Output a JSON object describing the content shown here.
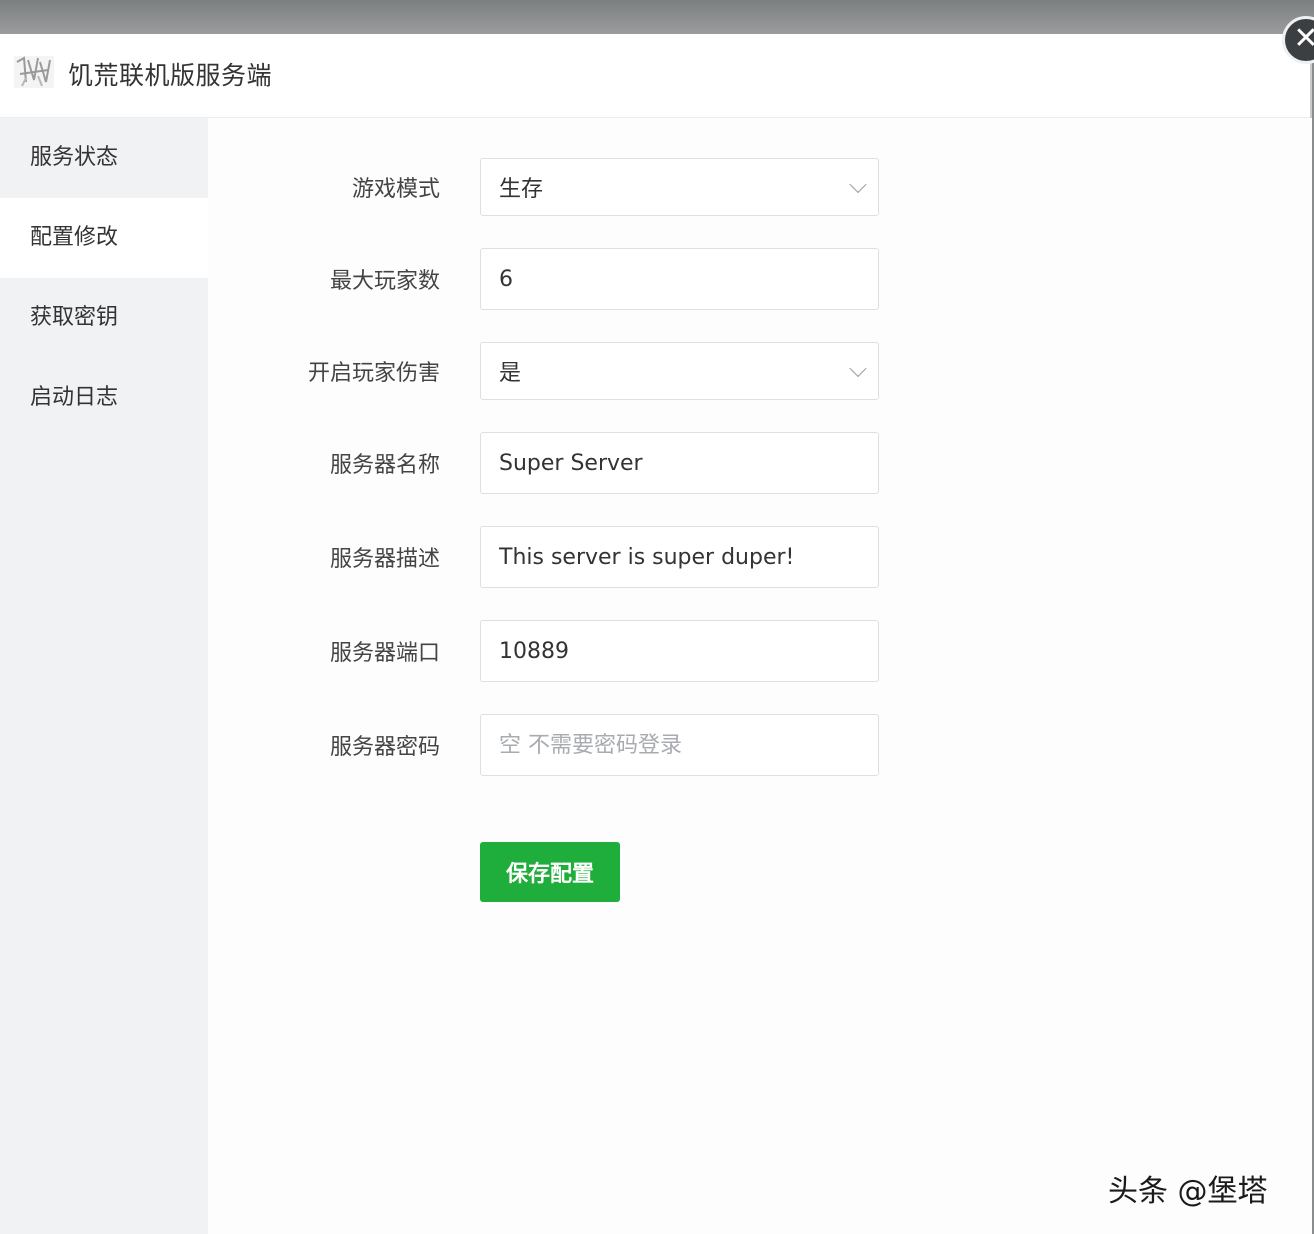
{
  "app": {
    "title": "饥荒联机版服务端"
  },
  "sidebar": {
    "items": [
      {
        "label": "服务状态",
        "active": false
      },
      {
        "label": "配置修改",
        "active": true
      },
      {
        "label": "获取密钥",
        "active": false
      },
      {
        "label": "启动日志",
        "active": false
      }
    ]
  },
  "form": {
    "game_mode": {
      "label": "游戏模式",
      "value": "生存"
    },
    "max_players": {
      "label": "最大玩家数",
      "value": "6"
    },
    "pvp": {
      "label": "开启玩家伤害",
      "value": "是"
    },
    "server_name": {
      "label": "服务器名称",
      "value": "Super Server"
    },
    "server_description": {
      "label": "服务器描述",
      "value": "This server is super duper!"
    },
    "server_port": {
      "label": "服务器端口",
      "value": "10889"
    },
    "server_password": {
      "label": "服务器密码",
      "value": "",
      "placeholder": "空 不需要密码登录"
    },
    "save_label": "保存配置"
  },
  "watermark": "头条 @堡塔",
  "colors": {
    "accent": "#1fad3b",
    "sidebar_bg": "#f1f2f4"
  },
  "icons": {
    "close": "close-icon",
    "logo": "app-logo-icon",
    "select": "chevron-down-icon"
  }
}
